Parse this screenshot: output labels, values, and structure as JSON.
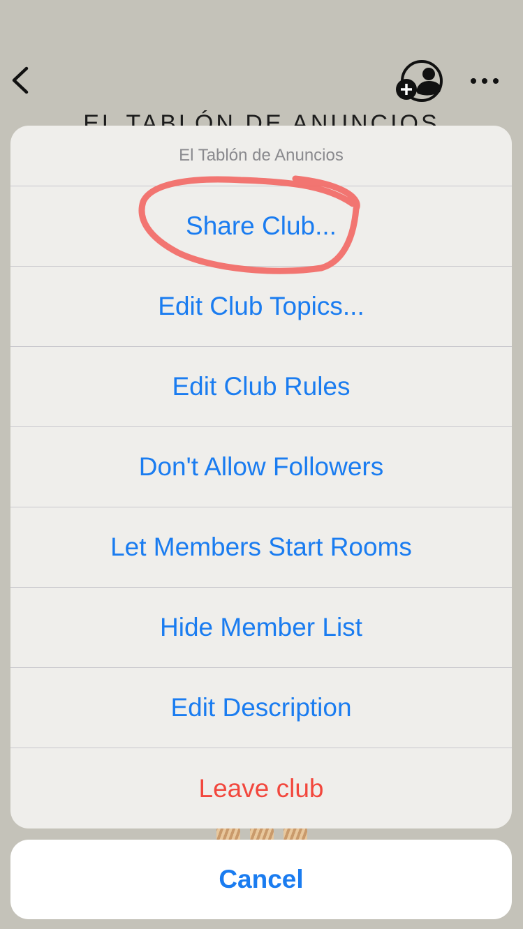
{
  "header": {
    "club_title": "El Tablón de Anuncios",
    "back_icon": "chevron-left-icon",
    "add_member_icon": "person-plus-icon",
    "more_icon": "ellipsis-icon"
  },
  "action_sheet": {
    "title": "El Tablón de Anuncios",
    "items": [
      {
        "label": "Share Club...",
        "style": "default"
      },
      {
        "label": "Edit Club Topics...",
        "style": "default"
      },
      {
        "label": "Edit Club Rules",
        "style": "default"
      },
      {
        "label": "Don't Allow Followers",
        "style": "default"
      },
      {
        "label": "Let Members Start Rooms",
        "style": "default"
      },
      {
        "label": "Hide Member List",
        "style": "default"
      },
      {
        "label": "Edit Description",
        "style": "default"
      },
      {
        "label": "Leave club",
        "style": "destructive"
      }
    ],
    "cancel_label": "Cancel"
  },
  "annotation": {
    "type": "hand-drawn-circle",
    "target": "Share Club...",
    "color": "#f26a66"
  },
  "colors": {
    "accent": "#1a7cf0",
    "destructive": "#f2473d",
    "backdrop": "#c4c2b9"
  }
}
